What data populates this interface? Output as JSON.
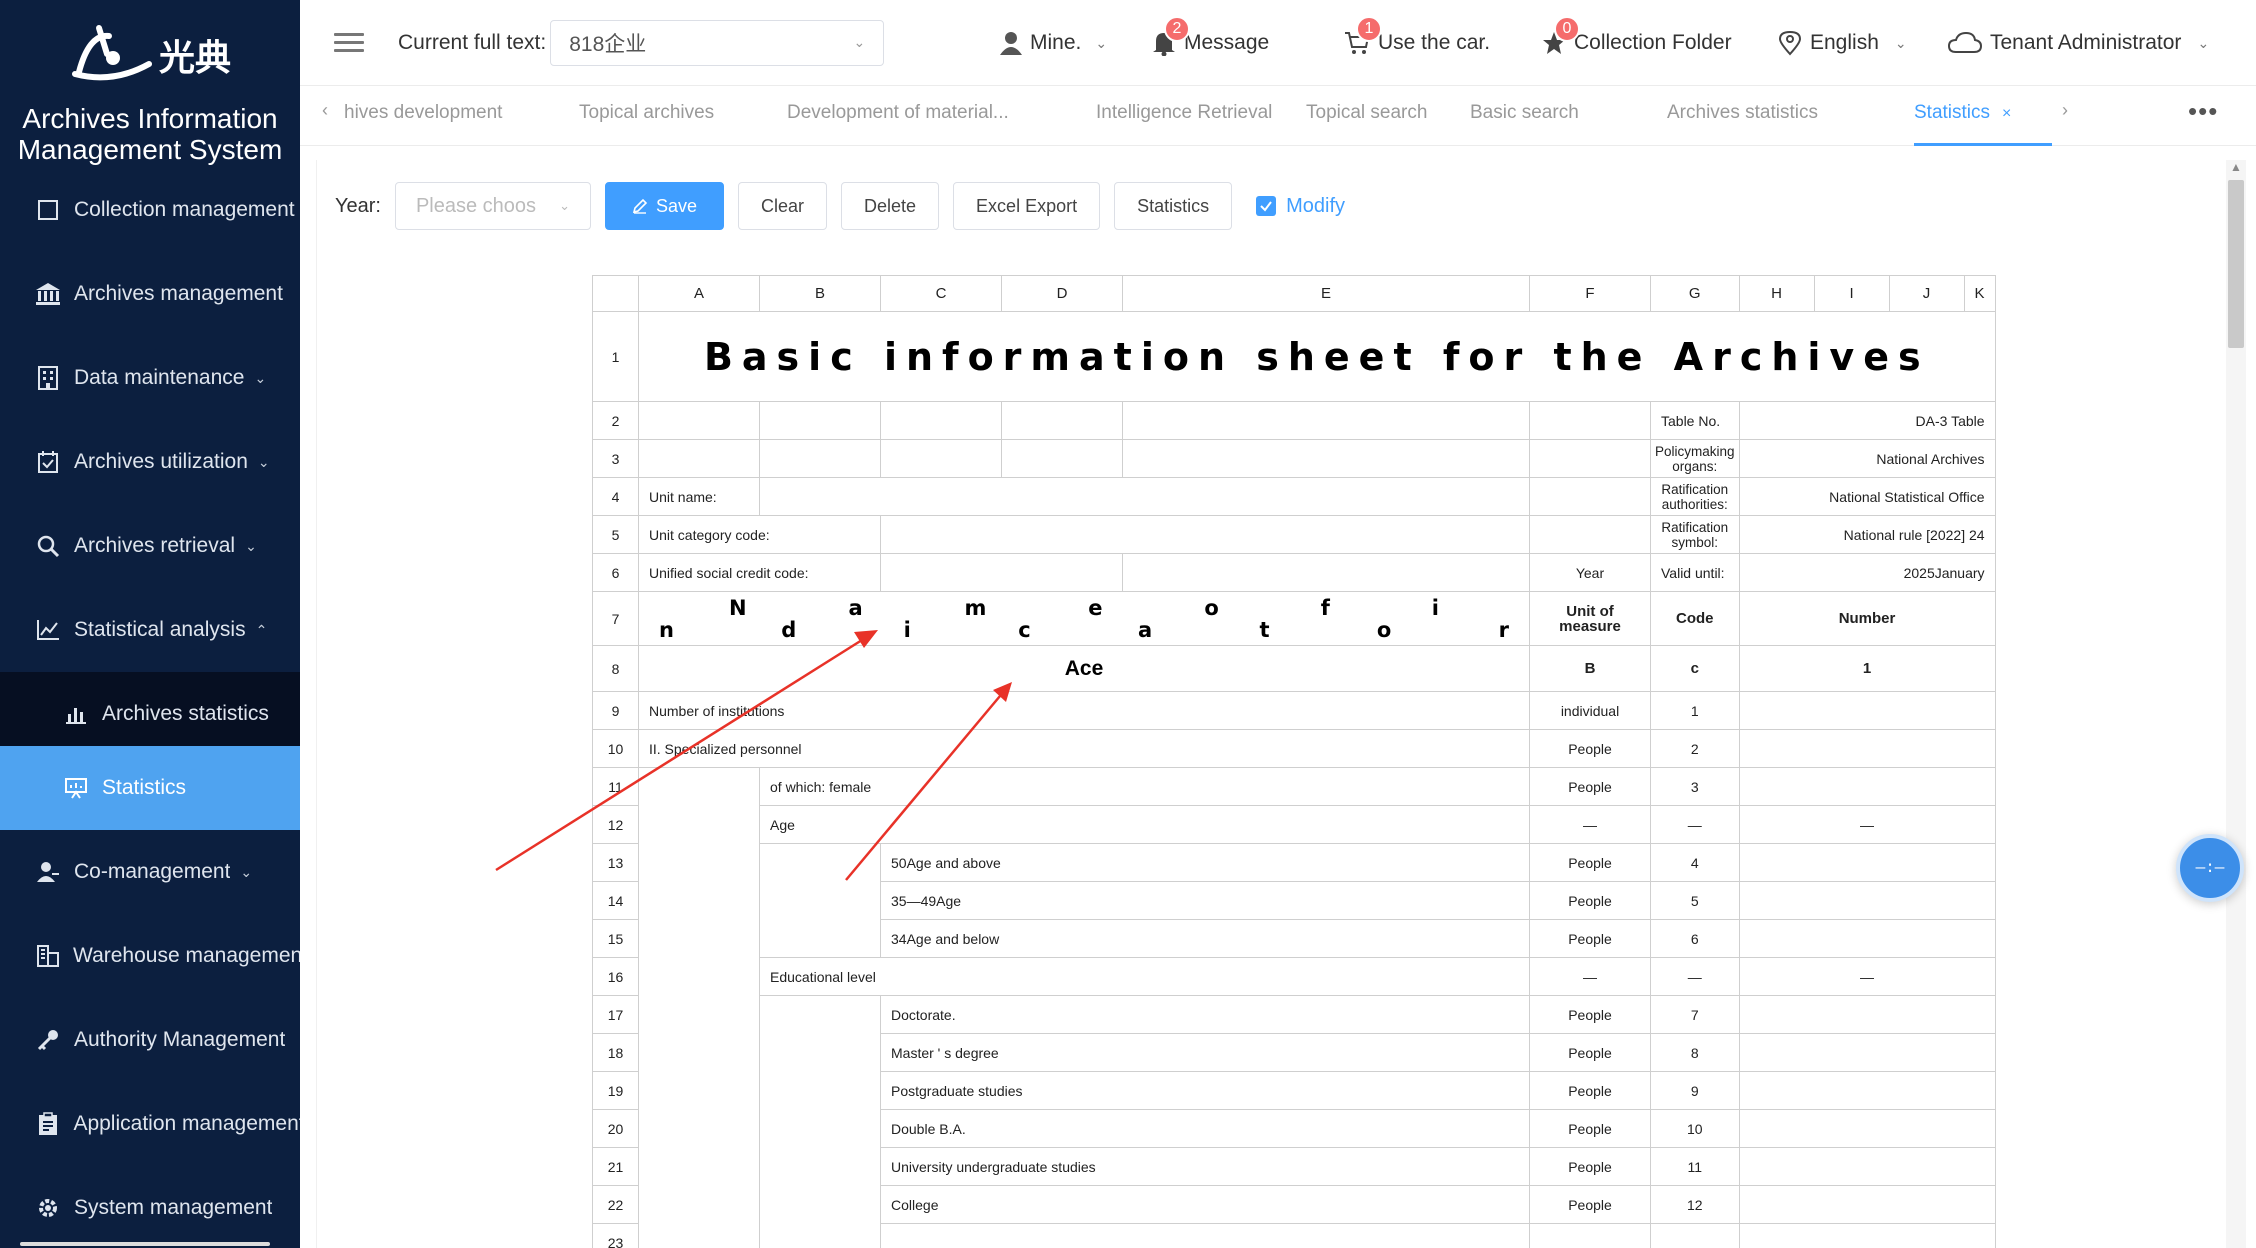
{
  "app": {
    "logo_text": "光典",
    "title_line1": "Archives Information",
    "title_line2": "Management System"
  },
  "sidebar": {
    "items": [
      {
        "label": "Collection management",
        "icon": "square-icon"
      },
      {
        "label": "Archives management",
        "icon": "bank-icon"
      },
      {
        "label": "Data maintenance",
        "icon": "building-icon"
      },
      {
        "label": "Archives utilization",
        "icon": "calendar-check-icon"
      },
      {
        "label": "Archives retrieval",
        "icon": "search-icon"
      },
      {
        "label": "Statistical analysis",
        "icon": "line-chart-icon"
      },
      {
        "label": "Archives statistics",
        "icon": "bar-chart-icon"
      },
      {
        "label": "Statistics",
        "icon": "presentation-icon"
      },
      {
        "label": "Co-management",
        "icon": "user-share-icon"
      },
      {
        "label": "Warehouse management",
        "icon": "warehouse-icon"
      },
      {
        "label": "Authority Management",
        "icon": "key-icon"
      },
      {
        "label": "Application management",
        "icon": "clipboard-icon"
      },
      {
        "label": "System management",
        "icon": "gear-icon"
      }
    ],
    "active_color": "#4fa3f0",
    "bg_color": "#0c1f3f"
  },
  "header": {
    "current_full_text_label": "Current full text:",
    "current_full_text_value": "818企业",
    "mine": "Mine.",
    "message": "Message",
    "message_badge": "2",
    "use_car": "Use the car.",
    "use_car_badge": "1",
    "collection_folder": "Collection Folder",
    "collection_badge": "0",
    "language": "English",
    "user": "Tenant Administrator"
  },
  "tabs": [
    {
      "label": "hives development"
    },
    {
      "label": "Topical archives"
    },
    {
      "label": "Development of material..."
    },
    {
      "label": "Intelligence Retrieval"
    },
    {
      "label": "Topical search"
    },
    {
      "label": "Basic search"
    },
    {
      "label": "Archives statistics"
    },
    {
      "label": "Statistics",
      "active": true
    }
  ],
  "toolbar": {
    "year_label": "Year:",
    "year_placeholder": "Please choos",
    "save": "Save",
    "clear": "Clear",
    "delete": "Delete",
    "excel_export": "Excel Export",
    "statistics": "Statistics",
    "modify": "Modify",
    "modify_checked": true
  },
  "sheet": {
    "columns": [
      "A",
      "B",
      "C",
      "D",
      "E",
      "F",
      "G",
      "H",
      "I",
      "J",
      "K"
    ],
    "title": "Basic information sheet for the Archives",
    "table_no_label": "Table No.",
    "table_no_value": "DA-3 Table",
    "policy_label": "Policymaking organs:",
    "policy_value": "National Archives",
    "ratification_auth_label": "Ratification authorities:",
    "ratification_auth_value": "National Statistical Office",
    "ratification_symbol_label": "Ratification symbol:",
    "ratification_symbol_value": "National rule [2022] 24",
    "unit_name_label": "Unit name:",
    "unit_category_label": "Unit category code:",
    "credit_code_label": "Unified social credit code:",
    "year_label": "Year",
    "valid_until_label": "Valid until:",
    "valid_until_value": "2025January",
    "indicator_header": "Name of indicator",
    "unit_header": "Unit of measure",
    "code_header": "Code",
    "number_header": "Number",
    "row8": {
      "a": "Ace",
      "f": "B",
      "g": "c",
      "k": "1"
    },
    "rows": [
      {
        "n": "9",
        "label": "Number of institutions",
        "indent": 0,
        "unit": "individual",
        "code": "1",
        "num": ""
      },
      {
        "n": "10",
        "label": "II. Specialized personnel",
        "indent": 0,
        "unit": "People",
        "code": "2",
        "num": ""
      },
      {
        "n": "11",
        "label": "of which: female",
        "indent": 1,
        "unit": "People",
        "code": "3",
        "num": ""
      },
      {
        "n": "12",
        "label": "Age",
        "indent": 1,
        "unit": "—",
        "code": "—",
        "num": "—"
      },
      {
        "n": "13",
        "label": "50Age and above",
        "indent": 2,
        "unit": "People",
        "code": "4",
        "num": ""
      },
      {
        "n": "14",
        "label": "35—49Age",
        "indent": 2,
        "unit": "People",
        "code": "5",
        "num": ""
      },
      {
        "n": "15",
        "label": "34Age and below",
        "indent": 2,
        "unit": "People",
        "code": "6",
        "num": ""
      },
      {
        "n": "16",
        "label": "Educational level",
        "indent": 1,
        "unit": "—",
        "code": "—",
        "num": "—"
      },
      {
        "n": "17",
        "label": "Doctorate.",
        "indent": 2,
        "unit": "People",
        "code": "7",
        "num": ""
      },
      {
        "n": "18",
        "label": "Master ' s degree",
        "indent": 2,
        "unit": "People",
        "code": "8",
        "num": ""
      },
      {
        "n": "19",
        "label": "Postgraduate studies",
        "indent": 2,
        "unit": "People",
        "code": "9",
        "num": ""
      },
      {
        "n": "20",
        "label": "Double B.A.",
        "indent": 2,
        "unit": "People",
        "code": "10",
        "num": ""
      },
      {
        "n": "21",
        "label": "University undergraduate studies",
        "indent": 2,
        "unit": "People",
        "code": "11",
        "num": ""
      },
      {
        "n": "22",
        "label": "College",
        "indent": 2,
        "unit": "People",
        "code": "12",
        "num": ""
      },
      {
        "n": "23",
        "label": "",
        "indent": 2,
        "unit": "",
        "code": "",
        "num": ""
      }
    ]
  },
  "annotation_color": "#e83228",
  "float_button_text": "—:—"
}
